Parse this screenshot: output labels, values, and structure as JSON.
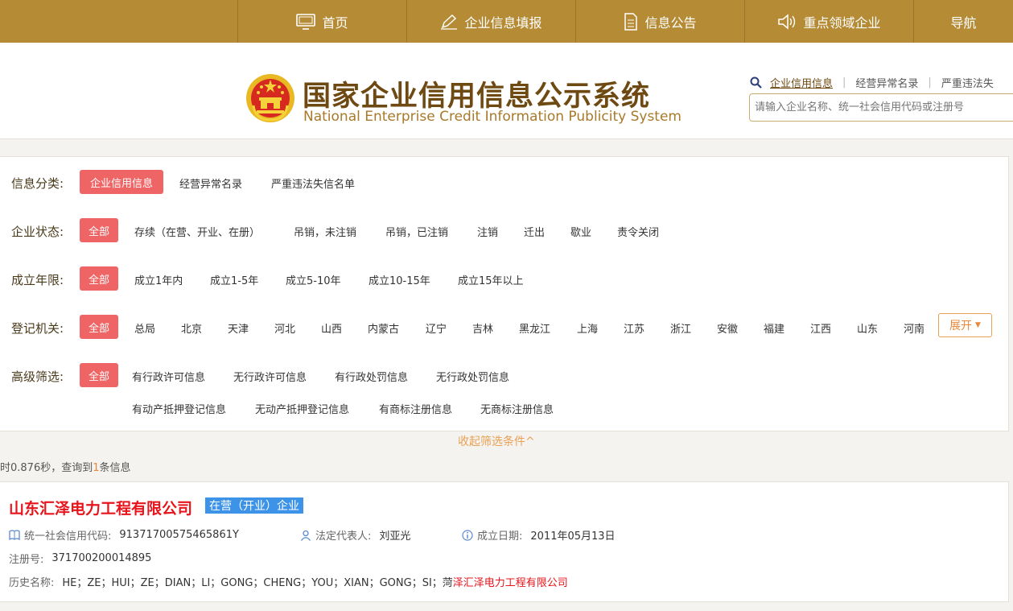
{
  "nav": {
    "home": "首页",
    "report": "企业信息填报",
    "notice": "信息公告",
    "key_sector": "重点领域企业",
    "guide": "导航"
  },
  "header": {
    "title_cn": "国家企业信用信息公示系统",
    "title_en": "National Enterprise Credit Information Publicity System",
    "search_tabs": [
      "企业信用信息",
      "经营异常名录",
      "严重违法失"
    ],
    "search_placeholder": "请输入企业名称、统一社会信用代码或注册号"
  },
  "filters": {
    "category": {
      "label": "信息分类:",
      "options": [
        "企业信用信息",
        "经营异常名录",
        "严重违法失信名单"
      ]
    },
    "status": {
      "label": "企业状态:",
      "options": [
        "全部",
        "存续（在营、开业、在册）",
        "吊销，未注销",
        "吊销，已注销",
        "注销",
        "迁出",
        "歇业",
        "责令关闭"
      ]
    },
    "age": {
      "label": "成立年限:",
      "options": [
        "全部",
        "成立1年内",
        "成立1-5年",
        "成立5-10年",
        "成立10-15年",
        "成立15年以上"
      ]
    },
    "authority": {
      "label": "登记机关:",
      "options": [
        "全部",
        "总局",
        "北京",
        "天津",
        "河北",
        "山西",
        "内蒙古",
        "辽宁",
        "吉林",
        "黑龙江",
        "上海",
        "江苏",
        "浙江",
        "安徽",
        "福建",
        "江西",
        "山东",
        "河南"
      ],
      "expand": "展开"
    },
    "advanced": {
      "label": "高级筛选:",
      "options": [
        "全部",
        "有行政许可信息",
        "无行政许可信息",
        "有行政处罚信息",
        "无行政处罚信息",
        "有动产抵押登记信息",
        "无动产抵押登记信息",
        "有商标注册信息",
        "无商标注册信息"
      ]
    },
    "collapse": "收起筛选条件^"
  },
  "results": {
    "timing_prefix": "时0.876秒，查询到",
    "count": "1",
    "timing_suffix": "条信息"
  },
  "company": {
    "name": "山东汇泽电力工程有限公司",
    "status": "在营（开业）企业",
    "credit_code_label": "统一社会信用代码:",
    "credit_code": "91371700575465861Y",
    "legal_rep_label": "法定代表人:",
    "legal_rep": "刘亚光",
    "est_date_label": "成立日期:",
    "est_date": "2011年05月13日",
    "reg_no_label": "注册号:",
    "reg_no": "371700200014895",
    "history_label": "历史名称:",
    "history_plain": "HE；ZE；HUI；ZE；DIAN；LI；GONG；CHENG；YOU；XIAN；GONG；SI；菏",
    "history_red": "泽汇泽电力工程有限公司"
  },
  "colors": {
    "nav_bg": "#b58b35",
    "selected": "#ef6565",
    "company_name": "#e8141b",
    "status_badge": "#3d93e8"
  }
}
